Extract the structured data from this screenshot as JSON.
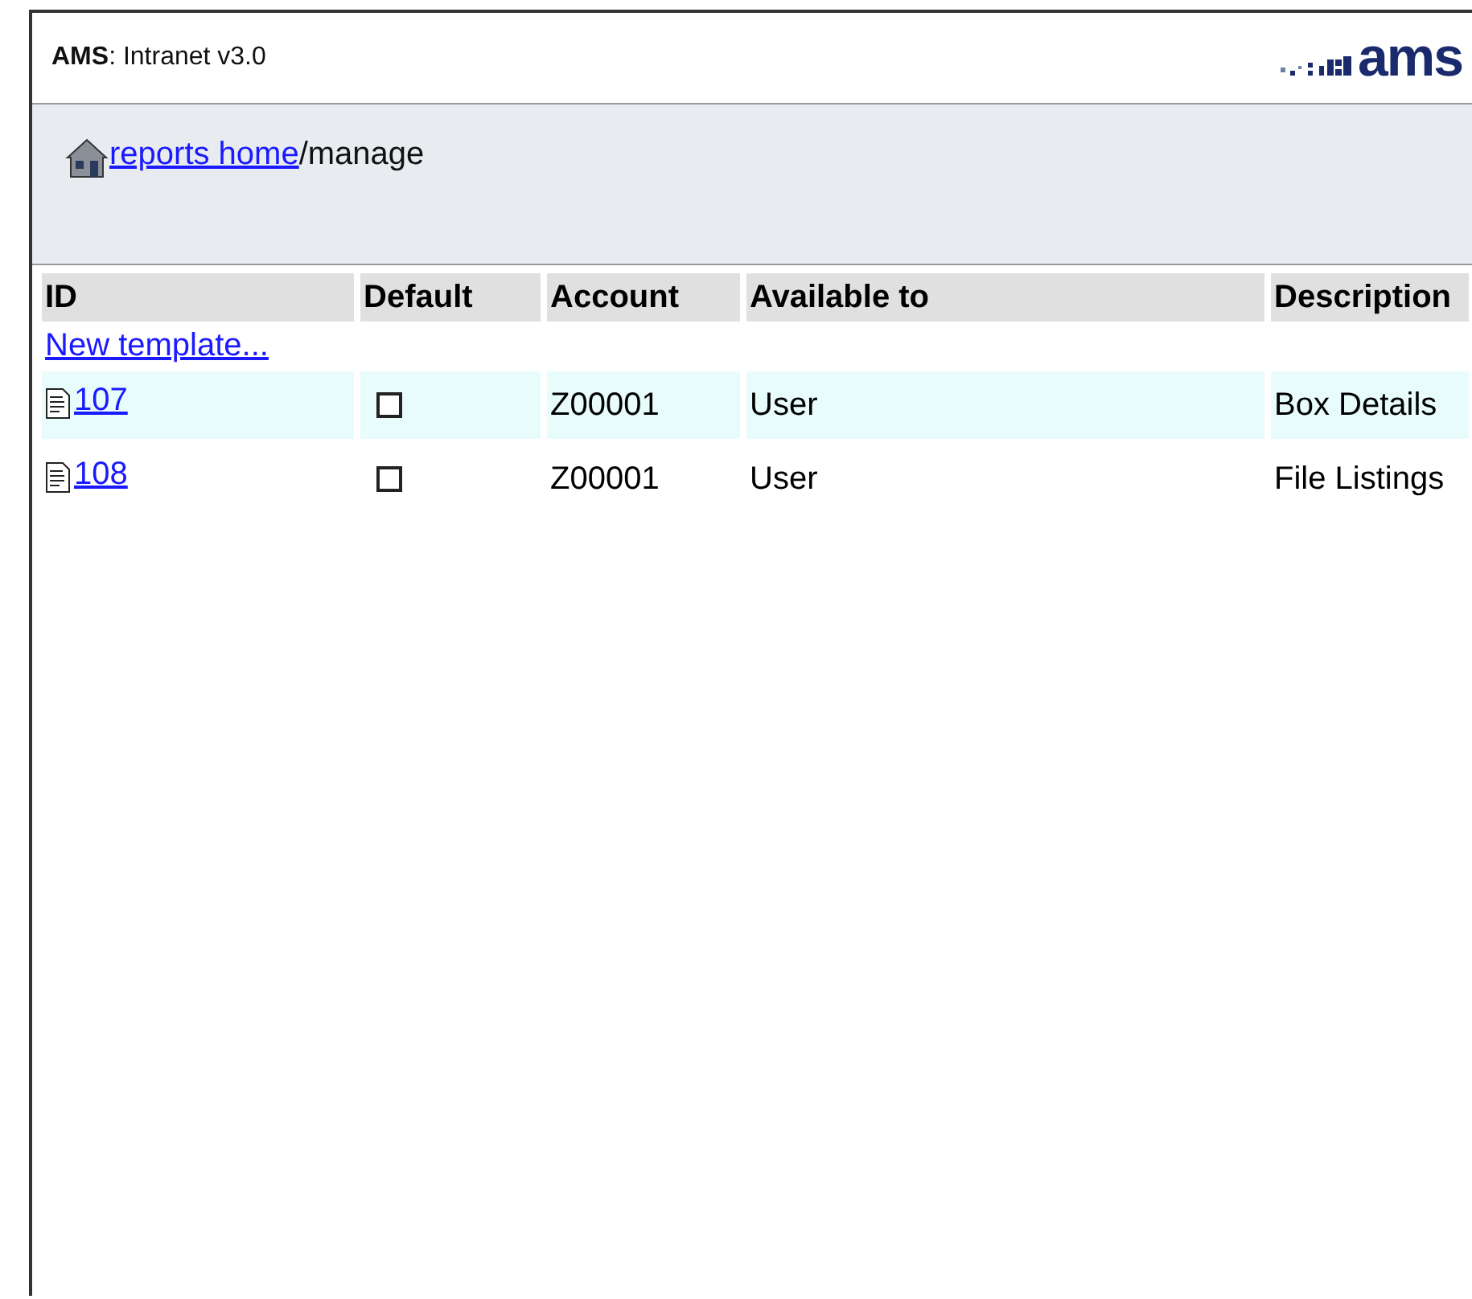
{
  "header": {
    "app": "AMS",
    "title": ": Intranet v3.0",
    "logo": "ams"
  },
  "breadcrumb": {
    "link": " reports home",
    "current": "/manage"
  },
  "table": {
    "columns": [
      "ID",
      "Default",
      "Account",
      "Available to",
      "Description"
    ],
    "new_link": "New template...",
    "rows": [
      {
        "id": "107",
        "checked": false,
        "account": "Z00001",
        "available_to": "User",
        "description": "Box Details",
        "selected": true
      },
      {
        "id": "108",
        "checked": false,
        "account": "Z00001",
        "available_to": "User",
        "description": "File Listings",
        "selected": false
      }
    ]
  }
}
